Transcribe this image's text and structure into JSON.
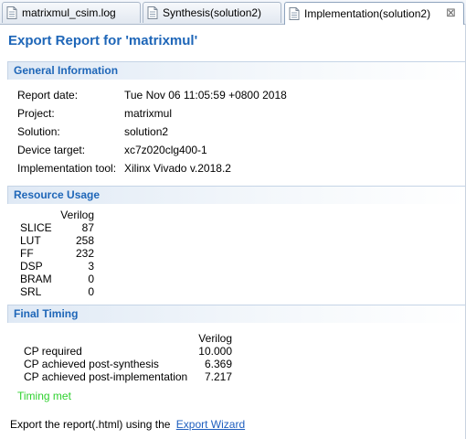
{
  "tabs": [
    {
      "label": "matrixmul_csim.log",
      "icon": "log-file-icon",
      "active": false
    },
    {
      "label": "Synthesis(solution2)",
      "icon": "report-icon",
      "active": false
    },
    {
      "label": "Implementation(solution2)",
      "icon": "report-icon",
      "active": true
    }
  ],
  "tab_close": "⊠",
  "report": {
    "title": "Export Report for 'matrixmul'"
  },
  "general": {
    "header": "General Information",
    "rows": [
      {
        "label": "Report date:",
        "value": "Tue Nov 06 11:05:59 +0800 2018"
      },
      {
        "label": "Project:",
        "value": "matrixmul"
      },
      {
        "label": "Solution:",
        "value": "solution2"
      },
      {
        "label": "Device target:",
        "value": "xc7z020clg400-1"
      },
      {
        "label": "Implementation tool:",
        "value": "Xilinx Vivado v.2018.2"
      }
    ]
  },
  "resource": {
    "header": "Resource Usage",
    "column": "Verilog",
    "rows": [
      {
        "name": "SLICE",
        "value": "87"
      },
      {
        "name": "LUT",
        "value": "258"
      },
      {
        "name": "FF",
        "value": "232"
      },
      {
        "name": "DSP",
        "value": "3"
      },
      {
        "name": "BRAM",
        "value": "0"
      },
      {
        "name": "SRL",
        "value": "0"
      }
    ]
  },
  "timing": {
    "header": "Final Timing",
    "column": "Verilog",
    "rows": [
      {
        "name": "CP required",
        "value": "10.000"
      },
      {
        "name": "CP achieved post-synthesis",
        "value": "6.369"
      },
      {
        "name": "CP achieved post-implementation",
        "value": "7.217"
      }
    ],
    "status": "Timing met"
  },
  "export": {
    "text": "Export the report(.html) using the",
    "link": "Export Wizard"
  },
  "colors": {
    "title_blue": "#1e66b8",
    "timing_met_green": "#2fd12f",
    "link_blue": "#1f5fbf"
  }
}
